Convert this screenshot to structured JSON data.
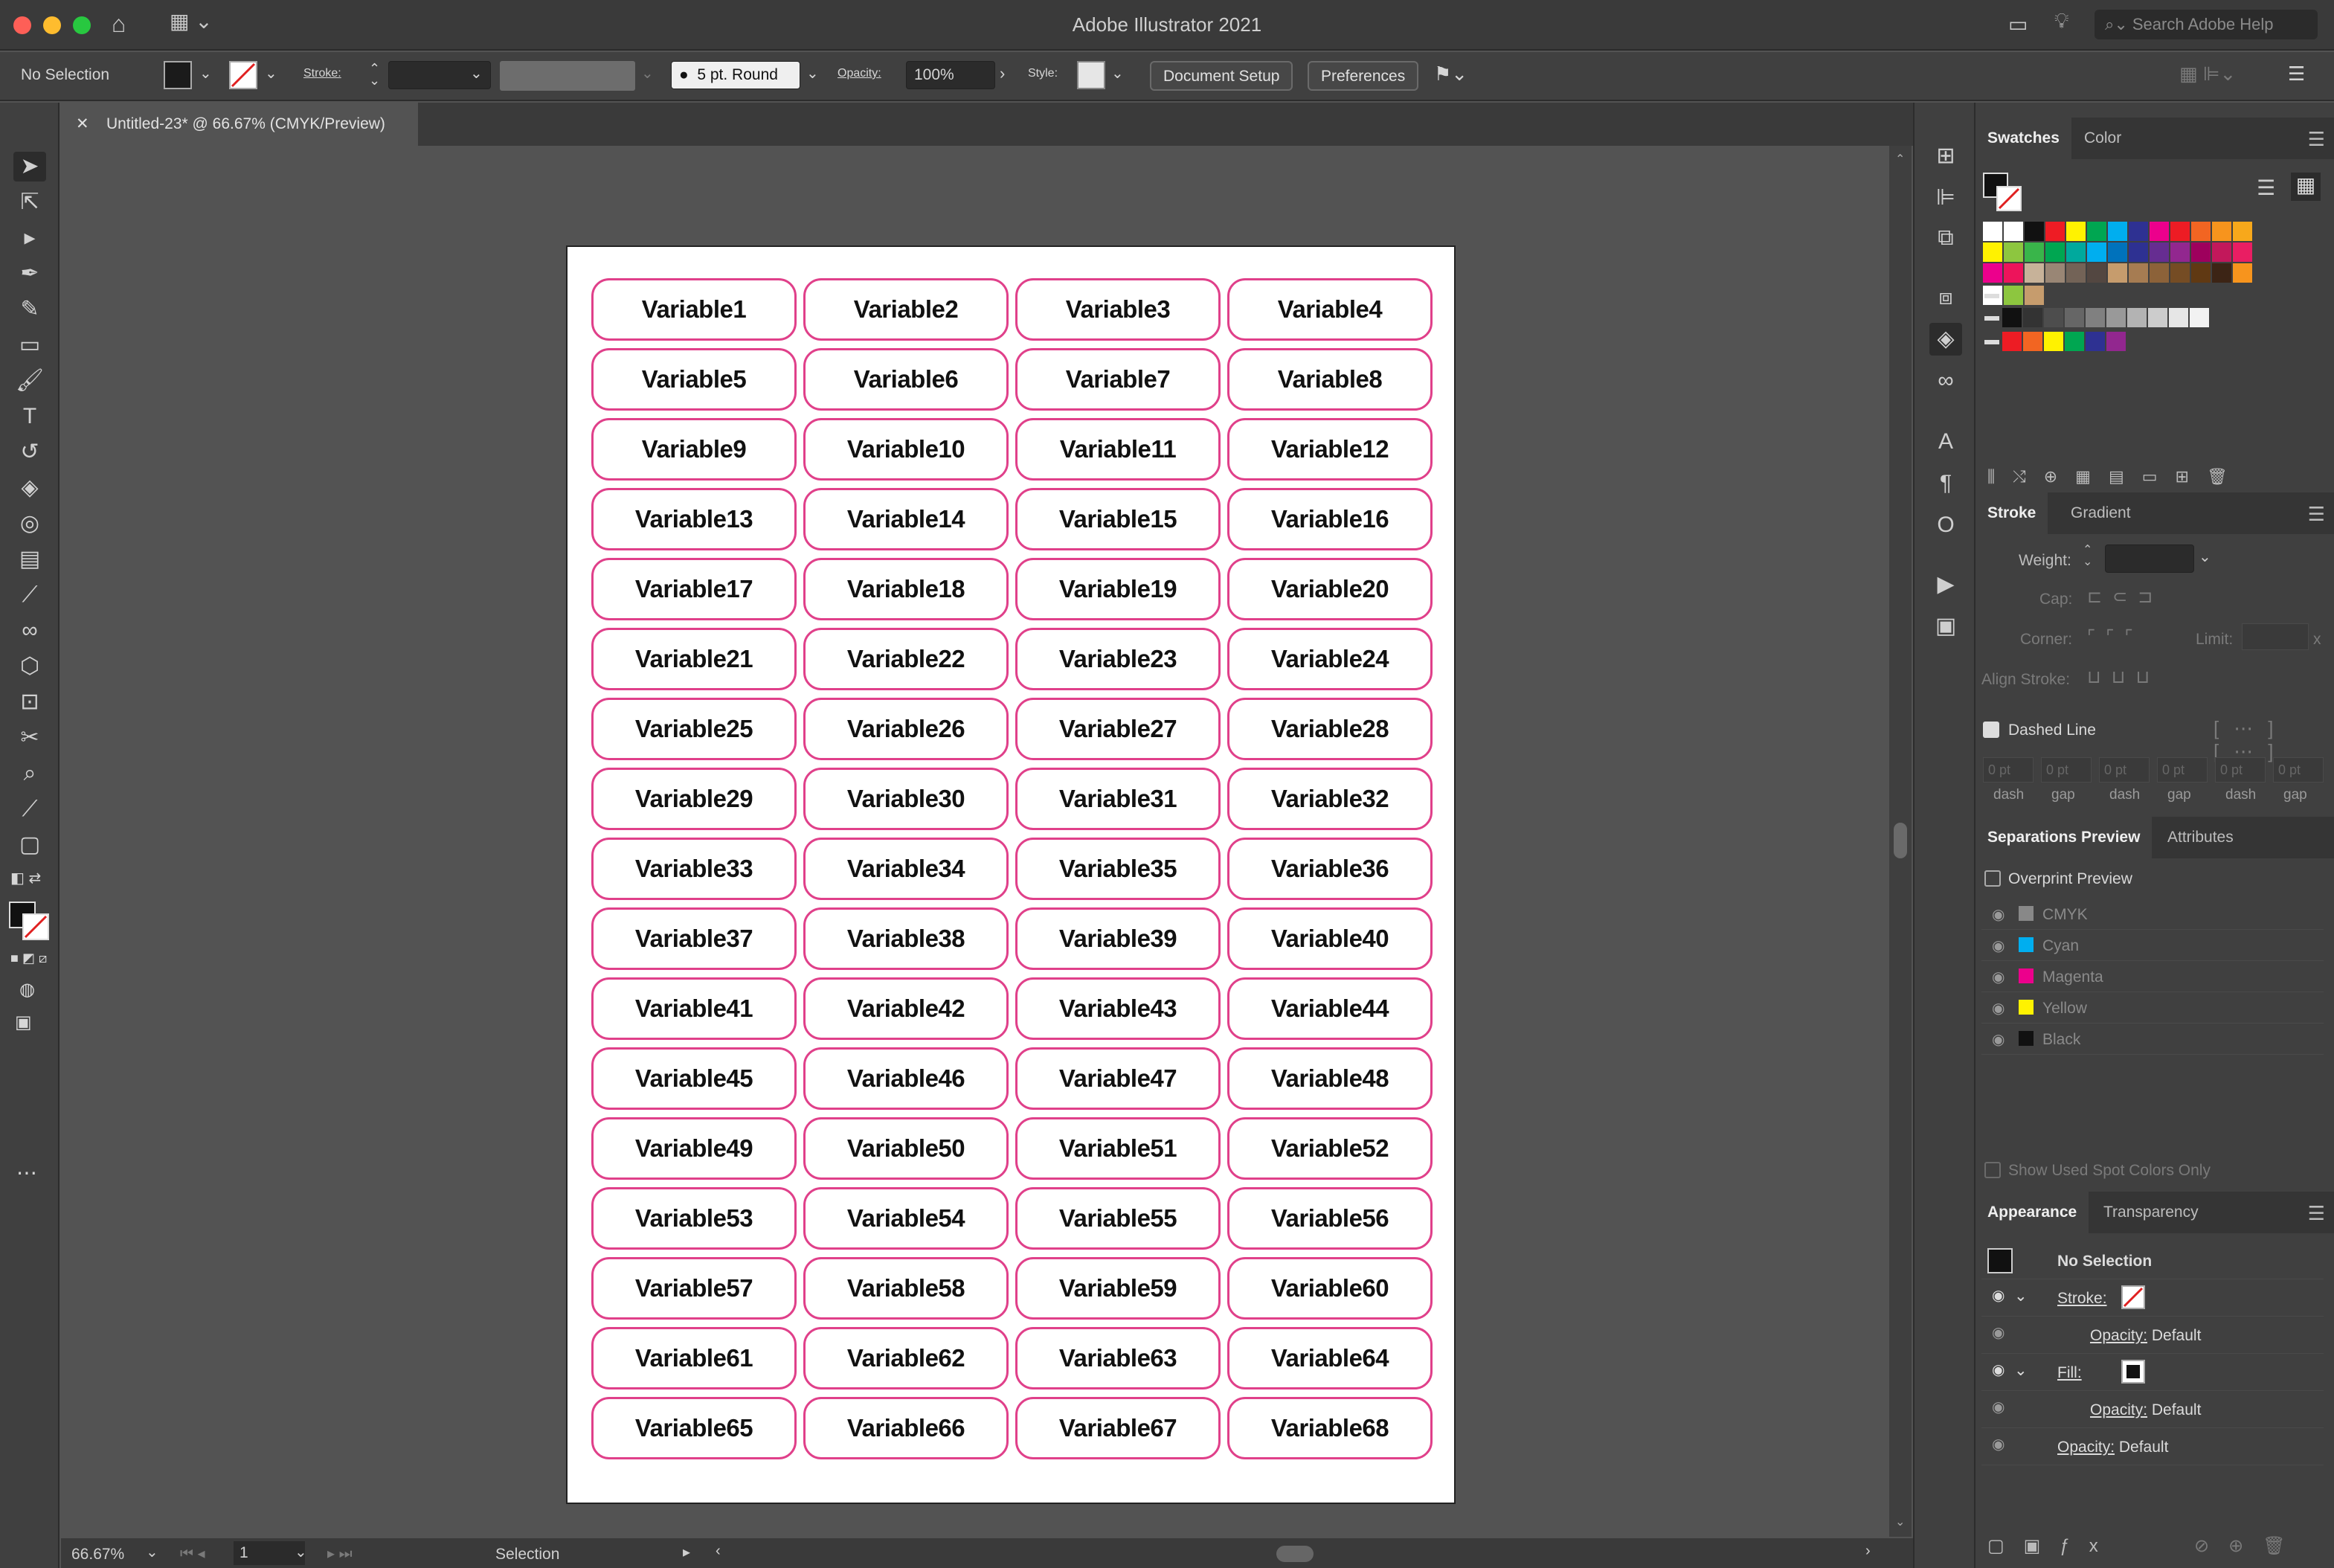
{
  "window": {
    "title": "Adobe Illustrator 2021",
    "search_placeholder": "Search Adobe Help"
  },
  "control_bar": {
    "selection": "No Selection",
    "stroke_label": "Stroke:",
    "brush": "5 pt. Round",
    "opacity_label": "Opacity:",
    "opacity_value": "100%",
    "style_label": "Style:",
    "document_setup": "Document Setup",
    "preferences": "Preferences"
  },
  "document": {
    "tab_title": "Untitled-23* @ 66.67% (CMYK/Preview)"
  },
  "labels": [
    "Variable1",
    "Variable2",
    "Variable3",
    "Variable4",
    "Variable5",
    "Variable6",
    "Variable7",
    "Variable8",
    "Variable9",
    "Variable10",
    "Variable11",
    "Variable12",
    "Variable13",
    "Variable14",
    "Variable15",
    "Variable16",
    "Variable17",
    "Variable18",
    "Variable19",
    "Variable20",
    "Variable21",
    "Variable22",
    "Variable23",
    "Variable24",
    "Variable25",
    "Variable26",
    "Variable27",
    "Variable28",
    "Variable29",
    "Variable30",
    "Variable31",
    "Variable32",
    "Variable33",
    "Variable34",
    "Variable35",
    "Variable36",
    "Variable37",
    "Variable38",
    "Variable39",
    "Variable40",
    "Variable41",
    "Variable42",
    "Variable43",
    "Variable44",
    "Variable45",
    "Variable46",
    "Variable47",
    "Variable48",
    "Variable49",
    "Variable50",
    "Variable51",
    "Variable52",
    "Variable53",
    "Variable54",
    "Variable55",
    "Variable56",
    "Variable57",
    "Variable58",
    "Variable59",
    "Variable60",
    "Variable61",
    "Variable62",
    "Variable63",
    "Variable64",
    "Variable65",
    "Variable66",
    "Variable67",
    "Variable68"
  ],
  "label_border_color": "#e0408a",
  "status_bar": {
    "zoom": "66.67%",
    "page": "1",
    "tool": "Selection"
  },
  "swatches_panel": {
    "tabs": [
      "Swatches",
      "Color"
    ],
    "row1": [
      "#ffffff",
      "#ffffff",
      "#111111",
      "#ee1c24",
      "#fff200",
      "#00a651",
      "#00aeef",
      "#2e3192",
      "#ec008c",
      "#ed1c24",
      "#f26522",
      "#f7941d",
      "#f7a81b"
    ],
    "row2": [
      "#fff200",
      "#8dc63f",
      "#39b54a",
      "#00a651",
      "#00a99d",
      "#00aeef",
      "#0072bc",
      "#2e3192",
      "#662d91",
      "#92278f",
      "#9e005d",
      "#c2185b",
      "#e91e63"
    ],
    "row3": [
      "#ec008c",
      "#ed145b",
      "#c7b299",
      "#998675",
      "#736357",
      "#534741",
      "#c69c6d",
      "#a67c52",
      "#8c6239",
      "#754c24",
      "#603913",
      "#3c2415",
      "#f7941d"
    ],
    "gray_row": [
      "#111111",
      "#333333",
      "#4d4d4d",
      "#666666",
      "#808080",
      "#999999",
      "#b3b3b3",
      "#cccccc",
      "#e6e6e6",
      "#f2f2f2"
    ],
    "bright_row": [
      "#ed1c24",
      "#f26522",
      "#fff200",
      "#00a651",
      "#2e3192",
      "#92278f"
    ]
  },
  "stroke_panel": {
    "tabs": [
      "Stroke",
      "Gradient"
    ],
    "weight": "Weight:",
    "cap": "Cap:",
    "corner": "Corner:",
    "limit": "Limit:",
    "align_stroke": "Align Stroke:",
    "dashed_line": "Dashed Line",
    "dash_fields": [
      "0 pt",
      "0 pt",
      "0 pt",
      "0 pt",
      "0 pt",
      "0 pt"
    ],
    "dash_labels": [
      "dash",
      "gap",
      "dash",
      "gap",
      "dash",
      "gap"
    ]
  },
  "separations_panel": {
    "tabs": [
      "Separations Preview",
      "Attributes"
    ],
    "overprint": "Overprint Preview",
    "plates": [
      {
        "name": "CMYK",
        "color": "#888888"
      },
      {
        "name": "Cyan",
        "color": "#00aeef"
      },
      {
        "name": "Magenta",
        "color": "#ec008c"
      },
      {
        "name": "Yellow",
        "color": "#fff200"
      },
      {
        "name": "Black",
        "color": "#111111"
      }
    ],
    "show_spot": "Show Used Spot Colors Only"
  },
  "appearance_panel": {
    "tabs": [
      "Appearance",
      "Transparency"
    ],
    "header": "No Selection",
    "stroke": "Stroke:",
    "fill": "Fill:",
    "opacity_label": "Opacity:",
    "opacity_value": "Default"
  }
}
